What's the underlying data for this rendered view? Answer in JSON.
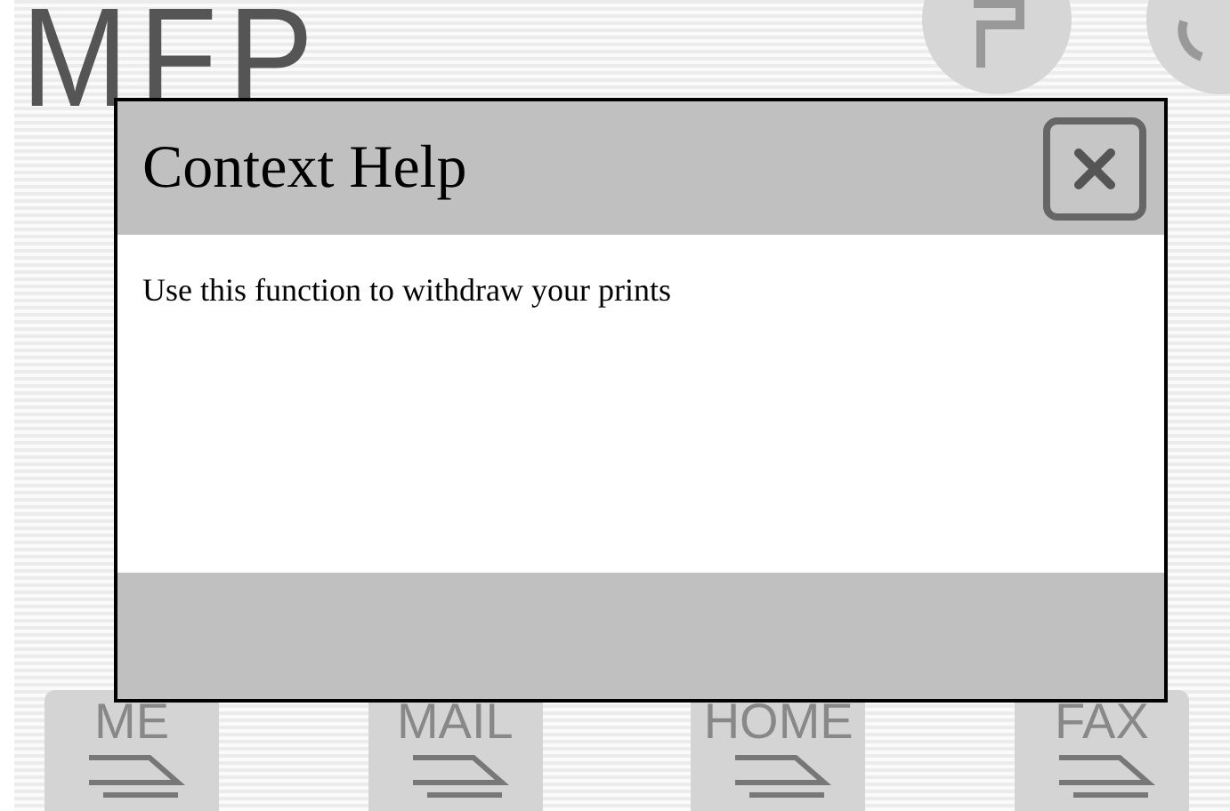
{
  "heading": "MFP",
  "dialog": {
    "title": "Context Help",
    "body": "Use this function to withdraw your prints"
  },
  "bottom_buttons": [
    {
      "label": "ME"
    },
    {
      "label": "MAIL"
    },
    {
      "label": "HOME"
    },
    {
      "label": "FAX"
    }
  ]
}
